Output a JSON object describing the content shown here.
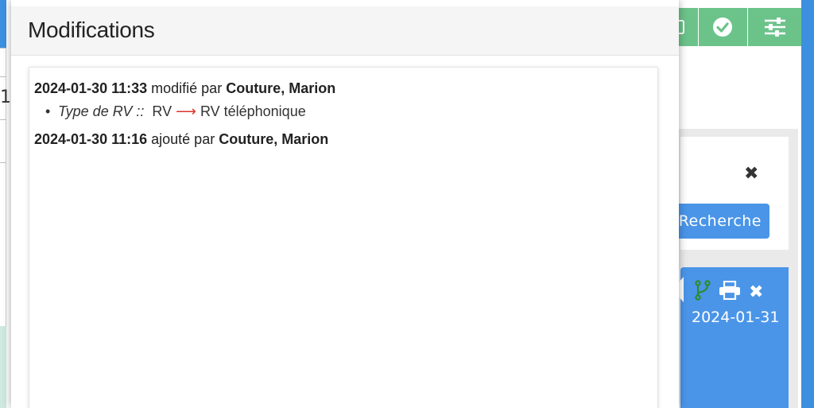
{
  "modal": {
    "title": "Modifications",
    "history": [
      {
        "timestamp": "2024-01-30 11:33",
        "action": "modifié par",
        "author": "Couture, Marion",
        "changes": [
          {
            "field": "Type de RV ::",
            "old_value": "RV",
            "arrow": "⟶",
            "new_value": "RV téléphonique"
          }
        ]
      },
      {
        "timestamp": "2024-01-30 11:16",
        "action": "ajouté par",
        "author": "Couture, Marion",
        "changes": []
      }
    ]
  },
  "background": {
    "left_fragment": "1",
    "toolbar_icons": [
      "calendar-icon",
      "check-circle-icon",
      "sliders-icon"
    ],
    "search_close": "✖",
    "search_button_label": "Recherche",
    "event_card": {
      "icons": [
        "fork-icon",
        "print-icon",
        "close-icon"
      ],
      "close_glyph": "✖",
      "date": "2024-01-31"
    }
  },
  "colors": {
    "accent_blue": "#4a95e8",
    "toolbar_green": "#6cc38a",
    "arrow_red": "#d9342b"
  }
}
